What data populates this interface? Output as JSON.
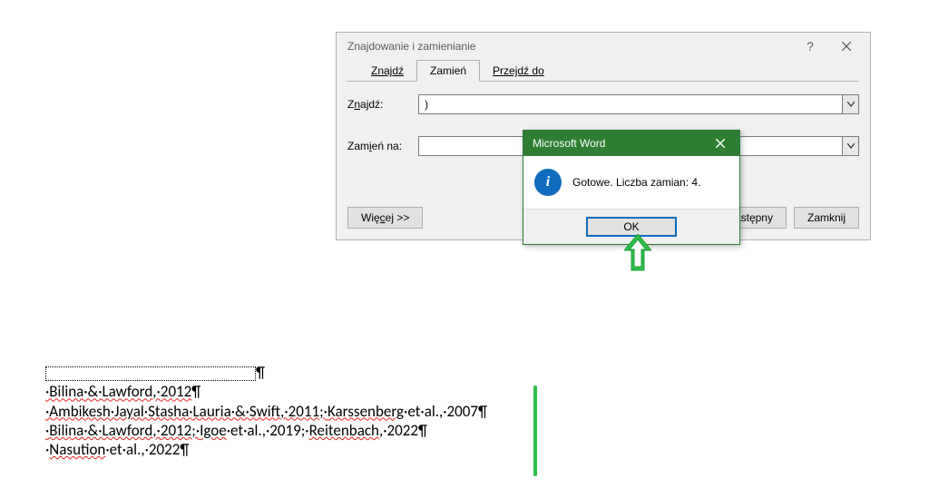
{
  "dialog": {
    "title": "Znajdowanie i zamienianie",
    "help_symbol": "?",
    "tabs": {
      "find": "Znajdź",
      "replace": "Zamień",
      "goto": "Przejdź do"
    },
    "find_label_pre": "Z",
    "find_label_ul": "n",
    "find_label_post": "ajdź:",
    "find_value": ")",
    "replace_label_pre": "Zam",
    "replace_label_ul": "i",
    "replace_label_post": "eń na:",
    "replace_value": "",
    "buttons": {
      "more_pre": "Wię",
      "more_ul": "c",
      "more_post": "ej >>",
      "find_next_visible": "ajdź następny",
      "close": "Zamknij"
    }
  },
  "msgbox": {
    "title": "Microsoft Word",
    "icon_letter": "i",
    "message": "Gotowe. Liczba zamian: 4.",
    "ok": "OK"
  },
  "doc": {
    "line1": "·Bilina·&·Lawford,·2012",
    "line2_a": "·Ambikesh·Jayal·Stasha·Lauria·&·Swift,·2011;·",
    "line2_b": "Karssenberg",
    "line2_c": "·et·al.,·2007",
    "line3_a": "·Bilina·&·Lawford,·2012;·",
    "line3_b": "Igoe",
    "line3_c": "·et·al.,·2019;·",
    "line3_d": "Reitenbach",
    "line3_e": ",·2022",
    "line4_a": "·",
    "line4_b": "Nasution",
    "line4_c": "·et·al.,·2022"
  }
}
